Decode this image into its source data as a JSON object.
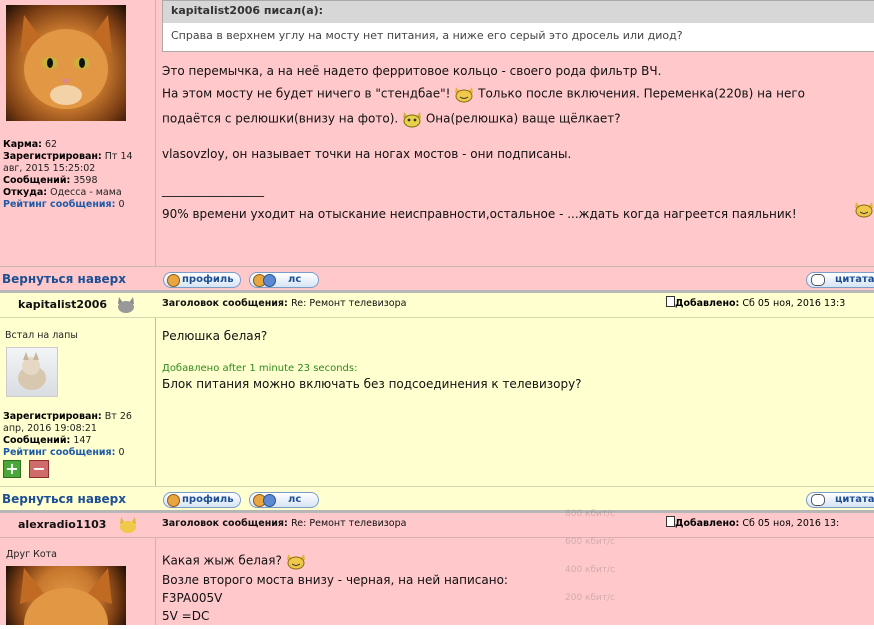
{
  "post1": {
    "meta": {
      "karma_label": "Карма:",
      "karma": "62",
      "reg_label": "Зарегистрирован:",
      "reg_value_1": "Пт 14",
      "reg_value_2": "авг, 2015 15:25:02",
      "posts_label": "Сообщений:",
      "posts": "3598",
      "from_label": "Откуда:",
      "from": "Одесса - мама",
      "rating_label": "Рейтинг сообщения:",
      "rating": "0"
    },
    "quote_author": "kapitalist2006 писал(а):",
    "quote_text": "Справа в верхнем углу на мосту нет питания, а ниже его серый это дросель или диод?",
    "lines": [
      "Это перемычка, а на неё надето ферритовое кольцо - своего рода фильтр ВЧ.",
      "На этом мосту не будет ничего в \"стендбае\"!",
      "Только после включения. Переменка(220в) на него",
      "подаётся с релюшки(внизу на фото).",
      "Она(релюшка) ваще щёлкает?",
      "vlasovzloy, он называет точки на ногах мостов - они подписаны.",
      "_________________",
      "90% времени уходит на отыскание неисправности,остальное - ...ждать когда нагреется паяльник!"
    ]
  },
  "actions": {
    "back": "Вернуться наверх",
    "profile": "профиль",
    "pm": "лс",
    "quote": "цитата"
  },
  "post2": {
    "author": "kapitalist2006",
    "title_label": "Заголовок сообщения:",
    "title": "Re: Ремонт телевизора",
    "added_label": "Добавлено:",
    "added": "Сб 05 ноя, 2016 13:3",
    "rank": "Встал на лапы",
    "meta": {
      "reg_label": "Зарегистрирован:",
      "reg_value_1": "Вт 26",
      "reg_value_2": "апр, 2016 19:08:21",
      "posts_label": "Сообщений:",
      "posts": "147",
      "rating_label": "Рейтинг сообщения:",
      "rating": "0"
    },
    "plus": "+",
    "minus": "−",
    "line1": "Релюшка белая?",
    "added_after": "Добавлено after 1 minute 23 seconds:",
    "line2": "Блок питания можно включать без подсоединения к телевизору?"
  },
  "post3": {
    "author": "alexradio1103",
    "title_label": "Заголовок сообщения:",
    "title": "Re: Ремонт телевизора",
    "added_label": "Добавлено:",
    "added": "Сб 05 ноя, 2016 13:",
    "rank": "Друг Кота",
    "lines": [
      "Какая жыж белая?",
      "Возле второго моста внизу - черная, на ней написано:",
      "F3PA005V",
      "5V =DC"
    ]
  },
  "overlay": {
    "l1": "800 кбит/с",
    "l2": "600 кбит/с",
    "l3": "400 кбит/с",
    "l4": "200 кбит/с"
  },
  "colors": {
    "pink": "#ffc8cb",
    "yellow": "#ffffd0",
    "link": "#1e4f93",
    "green": "#2f8a1e"
  }
}
